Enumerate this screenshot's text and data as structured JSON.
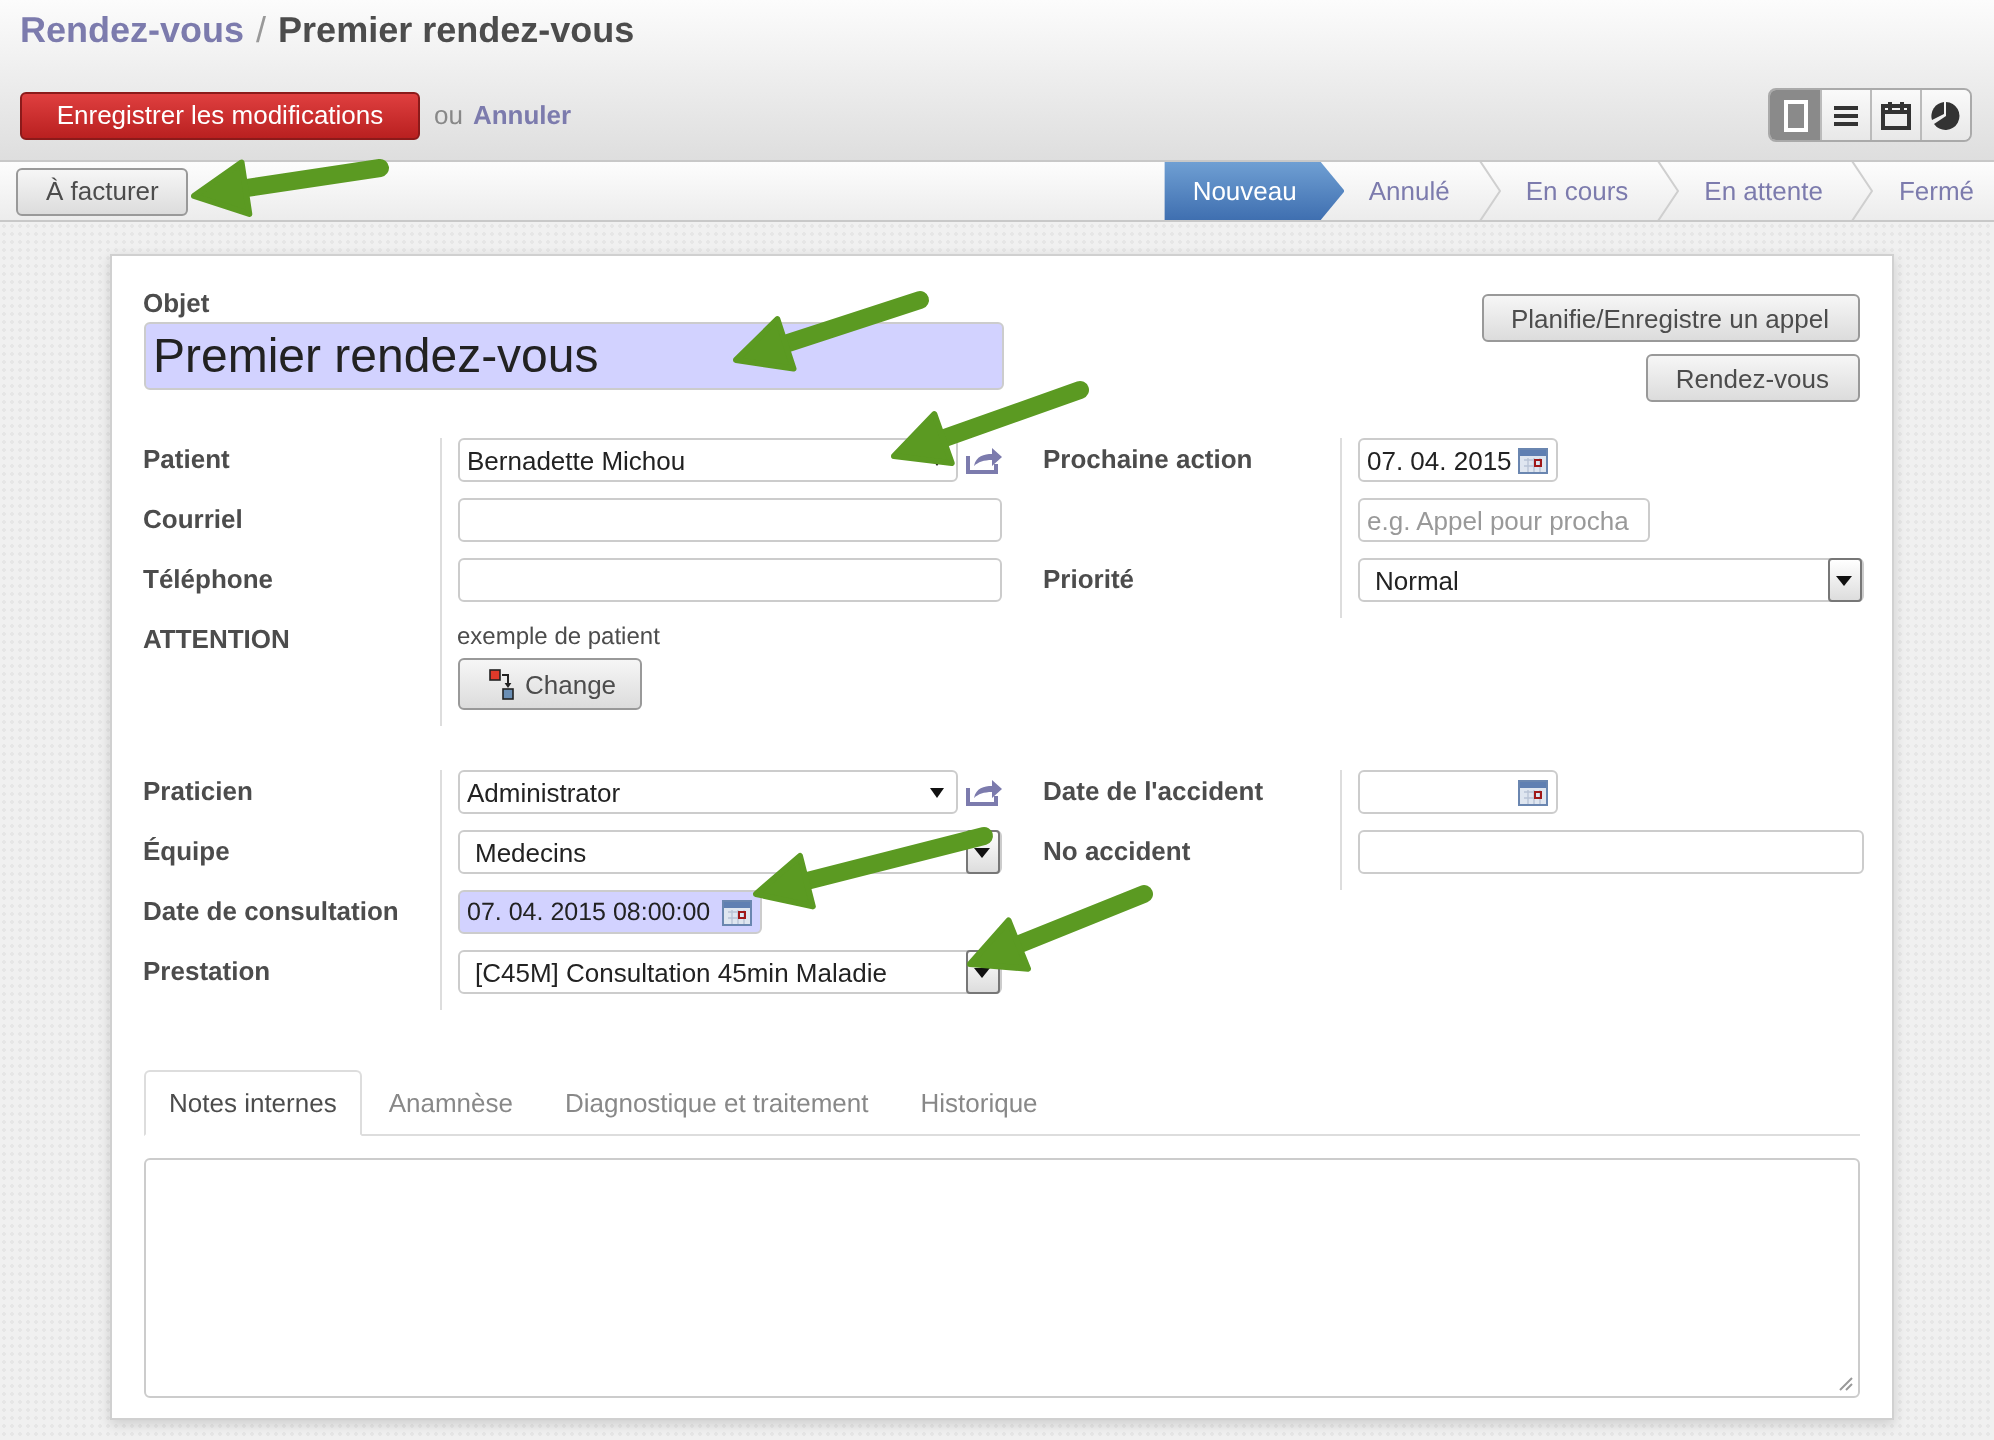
{
  "breadcrumb": {
    "parent": "Rendez-vous",
    "separator": "/",
    "current": "Premier rendez-vous"
  },
  "actions": {
    "save": "Enregistrer les modifications",
    "or": "ou",
    "cancel": "Annuler"
  },
  "view_switcher": [
    {
      "kind": "form",
      "selected": true
    },
    {
      "kind": "list",
      "selected": false
    },
    {
      "kind": "calendar",
      "selected": false
    },
    {
      "kind": "graph",
      "selected": false
    }
  ],
  "status_bar": {
    "button": "À facturer",
    "stages": [
      {
        "label": "Nouveau",
        "selected": true
      },
      {
        "label": "Annulé",
        "selected": false
      },
      {
        "label": "En cours",
        "selected": false
      },
      {
        "label": "En attente",
        "selected": false
      },
      {
        "label": "Fermé",
        "selected": false
      }
    ]
  },
  "form": {
    "title_label": "Objet",
    "title_value": "Premier rendez-vous",
    "title_highlighted": true,
    "side_buttons": [
      "Planifie/Enregistre un appel",
      "Rendez-vous"
    ],
    "groups": [
      {
        "left": [
          {
            "label": "Patient",
            "kind": "many2one",
            "value": "Bernadette Michou"
          },
          {
            "label": "Courriel",
            "kind": "char"
          },
          {
            "label": "Téléphone",
            "kind": "char"
          },
          {
            "label": "ATTENTION",
            "kind": "info",
            "value": "exemple de patient",
            "button": "Change"
          }
        ],
        "right": [
          {
            "label": "Prochaine action",
            "kind": "date",
            "value": "07. 04. 2015"
          },
          {
            "kind": "short_char",
            "placeholder": "e.g. Appel pour procha"
          },
          {
            "label": "Priorité",
            "kind": "selection",
            "value": "Normal"
          }
        ]
      },
      {
        "left": [
          {
            "label": "Praticien",
            "kind": "many2one",
            "value": "Administrator"
          },
          {
            "label": "Équipe",
            "kind": "selection",
            "value": "Medecins"
          },
          {
            "label": "Date de consultation",
            "kind": "datetime",
            "value": "07. 04. 2015 08:00:00",
            "highlighted": true
          },
          {
            "label": "Prestation",
            "kind": "selection",
            "value": "[C45M] Consultation 45min Maladie"
          }
        ],
        "right": [
          {
            "label": "Date de l'accident",
            "kind": "date"
          },
          {
            "label": "No accident",
            "kind": "char"
          }
        ]
      }
    ],
    "tabs": [
      {
        "label": "Notes internes",
        "selected": true
      },
      {
        "label": "Anamnèse",
        "selected": false
      },
      {
        "label": "Diagnostique et traitement",
        "selected": false
      },
      {
        "label": "Historique",
        "selected": false
      }
    ]
  }
}
